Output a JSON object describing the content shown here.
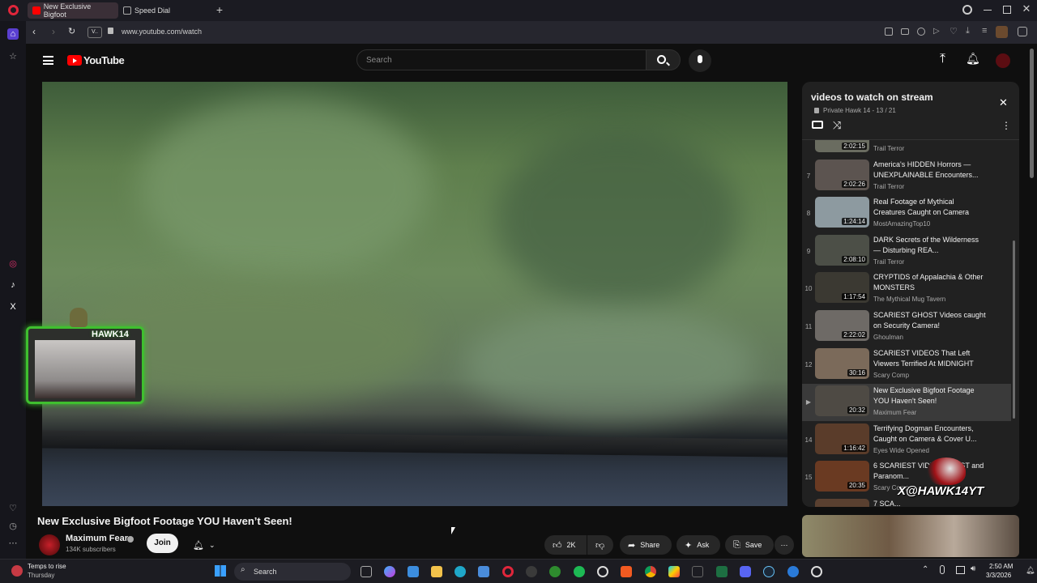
{
  "browser": {
    "tabs": [
      {
        "label": "New Exclusive Bigfoot",
        "active": true
      },
      {
        "label": "Speed Dial",
        "active": false
      }
    ],
    "address_chip": "V..",
    "url": "www.youtube.com/watch"
  },
  "youtube": {
    "logo_text": "YouTube",
    "search_placeholder": "Search"
  },
  "video": {
    "title": "New Exclusive Bigfoot Footage YOU Haven’t Seen!",
    "channel": "Maximum Fear",
    "subscribers": "134K subscribers",
    "join_label": "Join",
    "likes": "2K",
    "share_label": "Share",
    "ask_label": "Ask",
    "save_label": "Save"
  },
  "overlay": {
    "webcam_name": "HAWK14",
    "brand_text": "X@HAWK14YT"
  },
  "playlist": {
    "title": "videos to watch on stream",
    "meta": "Private Hawk 14 - 13 / 21",
    "items": [
      {
        "num": "",
        "title": "",
        "channel": "Trail Terror",
        "duration": "2:02:15"
      },
      {
        "num": "7",
        "title": "America's HIDDEN Horrors — UNEXPLAINABLE Encounters...",
        "channel": "Trail Terror",
        "duration": "2:02:26"
      },
      {
        "num": "8",
        "title": "Real Footage of Mythical Creatures Caught on Camera",
        "channel": "MostAmazingTop10",
        "duration": "1:24:14"
      },
      {
        "num": "9",
        "title": "DARK Secrets of the Wilderness — Disturbing REA...",
        "channel": "Trail Terror",
        "duration": "2:08:10"
      },
      {
        "num": "10",
        "title": "CRYPTIDS of Appalachia & Other MONSTERS",
        "channel": "The Mythical Mug Tavern",
        "duration": "1:17:54"
      },
      {
        "num": "11",
        "title": "SCARIEST GHOST Videos caught on Security Camera!",
        "channel": "Ghoulman",
        "duration": "2:22:02"
      },
      {
        "num": "12",
        "title": "SCARIEST VIDEOS That Left Viewers Terrified At MIDNIGHT",
        "channel": "Scary Comp",
        "duration": "30:16"
      },
      {
        "num": "▶",
        "title": "New Exclusive Bigfoot Footage YOU Haven't Seen!",
        "channel": "Maximum Fear",
        "duration": "20:32"
      },
      {
        "num": "14",
        "title": "Terrifying Dogman Encounters, Caught on Camera & Cover U...",
        "channel": "Eyes Wide Opened",
        "duration": "1:16:42"
      },
      {
        "num": "15",
        "title": "6 SCARIEST VIDEO... ...OST and Paranom...",
        "channel": "Scary Comp",
        "duration": "20:35"
      },
      {
        "num": "16",
        "title": "7 SCA...",
        "channel": "",
        "duration": ""
      }
    ]
  },
  "taskbar": {
    "weather_line1": "Temps to rise",
    "weather_line2": "Thursday",
    "search_label": "Search",
    "time": "2:50 AM",
    "date": "3/3/2026"
  }
}
